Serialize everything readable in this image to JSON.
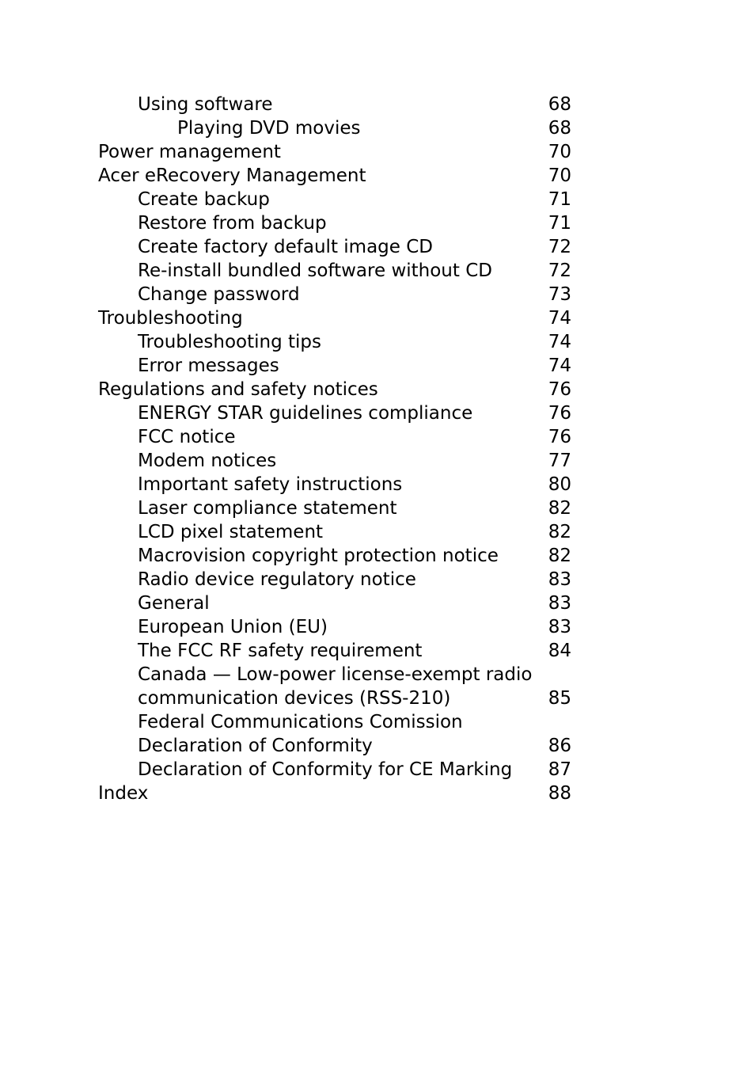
{
  "toc": {
    "entries": [
      {
        "title": "Using software",
        "page": "68",
        "level": 1
      },
      {
        "title": "Playing DVD movies",
        "page": "68",
        "level": 2
      },
      {
        "title": "Power management",
        "page": "70",
        "level": 0
      },
      {
        "title": "Acer eRecovery Management",
        "page": "70",
        "level": 0
      },
      {
        "title": "Create backup",
        "page": "71",
        "level": 1
      },
      {
        "title": "Restore from backup",
        "page": "71",
        "level": 1
      },
      {
        "title": "Create factory default image CD",
        "page": "72",
        "level": 1
      },
      {
        "title": "Re-install bundled software without CD",
        "page": "72",
        "level": 1
      },
      {
        "title": "Change password",
        "page": "73",
        "level": 1
      },
      {
        "title": "Troubleshooting",
        "page": "74",
        "level": 0
      },
      {
        "title": "Troubleshooting tips",
        "page": "74",
        "level": 1
      },
      {
        "title": "Error messages",
        "page": "74",
        "level": 1
      },
      {
        "title": "Regulations and safety notices",
        "page": "76",
        "level": 0
      },
      {
        "title": "ENERGY STAR guidelines compliance",
        "page": "76",
        "level": 1
      },
      {
        "title": "FCC notice",
        "page": "76",
        "level": 1
      },
      {
        "title": "Modem notices",
        "page": "77",
        "level": 1
      },
      {
        "title": "Important safety instructions",
        "page": "80",
        "level": 1
      },
      {
        "title": "Laser compliance statement",
        "page": "82",
        "level": 1
      },
      {
        "title": "LCD pixel statement",
        "page": "82",
        "level": 1
      },
      {
        "title": "Macrovision copyright protection notice",
        "page": "82",
        "level": 1
      },
      {
        "title": "Radio device regulatory notice",
        "page": "83",
        "level": 1
      },
      {
        "title": "General",
        "page": "83",
        "level": 1
      },
      {
        "title": "European Union (EU)",
        "page": "83",
        "level": 1
      },
      {
        "title": "The FCC RF safety requirement",
        "page": "84",
        "level": 1
      },
      {
        "title": "Canada — Low-power license-exempt radio",
        "page": "",
        "level": 1
      },
      {
        "title": "communication devices (RSS-210)",
        "page": "85",
        "level": 1
      },
      {
        "title": "Federal Communications Comission",
        "page": "",
        "level": 1
      },
      {
        "title": "Declaration of Conformity",
        "page": "86",
        "level": 1
      },
      {
        "title": "Declaration of Conformity for CE Marking",
        "page": "87",
        "level": 1
      },
      {
        "title": "Index",
        "page": "88",
        "level": 0
      }
    ]
  }
}
